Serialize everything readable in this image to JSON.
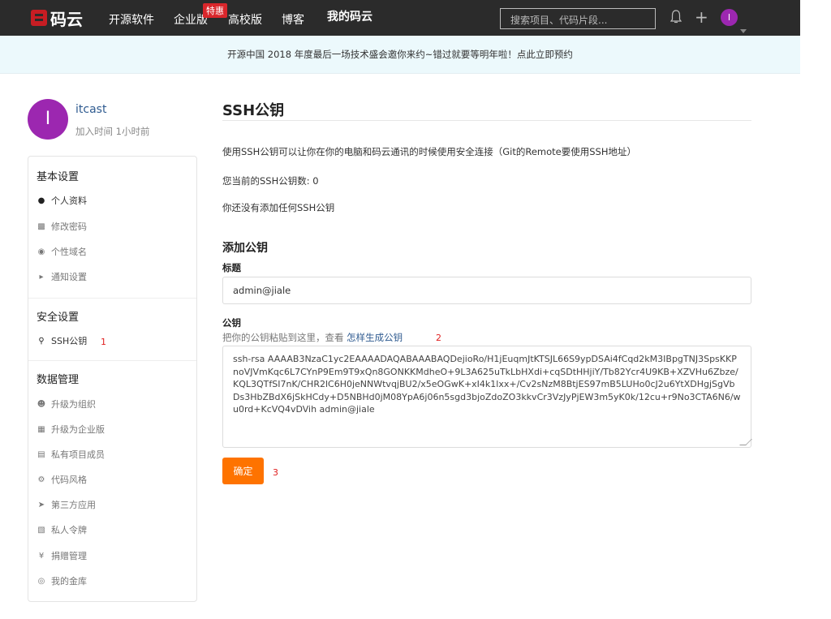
{
  "header": {
    "logo_text": "码云",
    "nav": [
      "开源软件",
      "企业版",
      "高校版",
      "博客",
      "我的码云"
    ],
    "hot_badge": "特惠",
    "search_placeholder": "搜索项目、代码片段...",
    "avatar_initial": "I"
  },
  "banner": {
    "text": "开源中国 2018 年度最后一场技术盛会邀你来约~错过就要等明年啦！点此立即预约"
  },
  "profile": {
    "initial": "I",
    "name": "itcast",
    "join_time": "加入时间 1小时前"
  },
  "sidebar": {
    "groups": [
      {
        "title": "基本设置",
        "items": [
          "个人资料",
          "修改密码",
          "个性域名",
          "通知设置"
        ]
      },
      {
        "title": "安全设置",
        "items": [
          "SSH公钥"
        ]
      },
      {
        "title": "数据管理",
        "items": [
          "升级为组织",
          "升级为企业版",
          "私有项目成员",
          "代码风格",
          "第三方应用",
          "私人令牌",
          "捐赠管理",
          "我的金库"
        ]
      }
    ],
    "annotation": "1"
  },
  "main": {
    "title": "SSH公钥",
    "description": "使用SSH公钥可以让你在你的电脑和码云通讯的时候使用安全连接（Git的Remote要使用SSH地址）",
    "count_text": "您当前的SSH公钥数: 0",
    "empty_text": "你还没有添加任何SSH公钥",
    "add_title": "添加公钥",
    "title_label": "标题",
    "title_value": "admin@jiale",
    "key_label": "公钥",
    "key_hint": "把你的公钥粘贴到这里，查看 ",
    "key_hint_link": "怎样生成公钥",
    "key_hint_annotation": "2",
    "key_value": "ssh-rsa AAAAB3NzaC1yc2EAAAADAQABAAABAQDejioRo/H1jEuqmJtKTSJL66S9ypDSAi4fCqd2kM3IBpgTNJ3SpsKKPnoVJVmKqc6L7CYnP9Em9T9xQn8GONKKMdheO+9L3A625uTkLbHXdi+cqSDtHHjiY/Tb82Ycr4U9KB+XZVHu6Zbze/KQL3QTfSI7nK/CHR2lC6H0jeNNWtvqjBU2/x5eOGwK+xI4k1lxx+/Cv2sNzM8BtjES97mB5LUHo0cJ2u6YtXDHgjSgVbDs3HbZBdX6jSkHCdy+D5NBHd0jM08YpA6j06n5sgd3bjoZdoZO3kkvCr3VzJyPjEW3m5yK0k/12cu+r9No3CTA6N6/wu0rd+KcVQ4vDVih admin@jiale",
    "confirm_label": "确定",
    "confirm_annotation": "3"
  }
}
